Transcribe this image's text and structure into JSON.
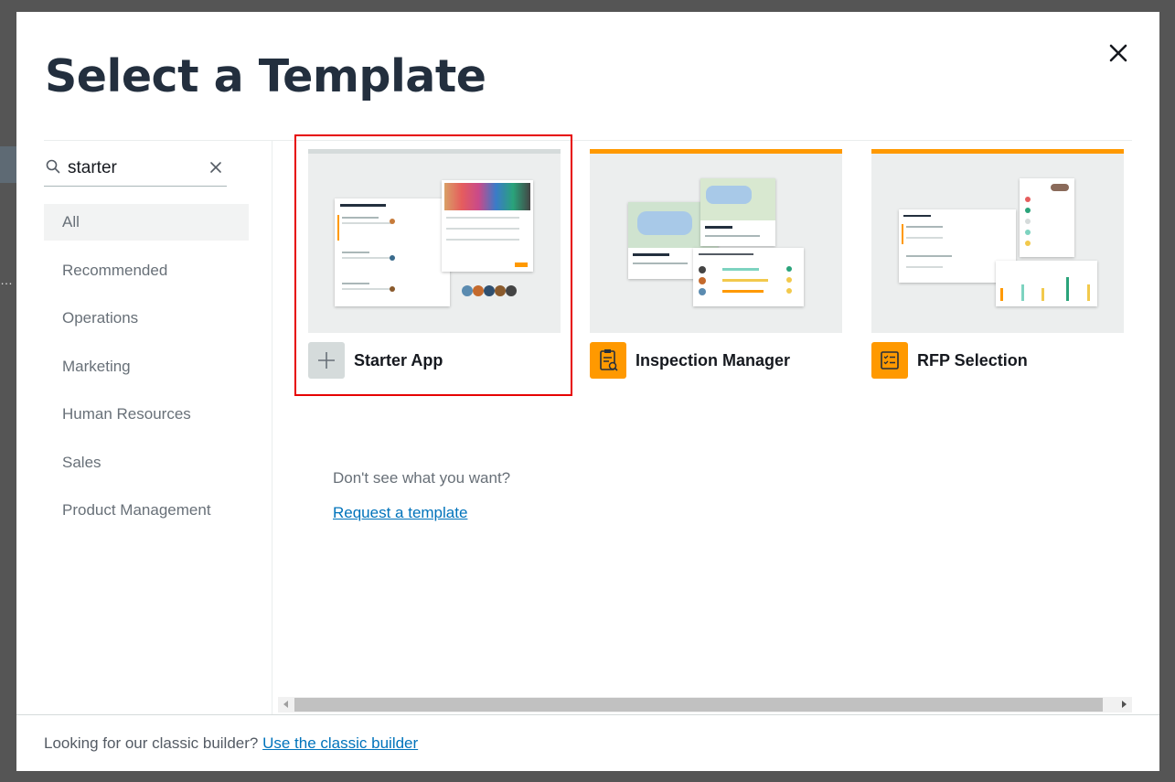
{
  "modal": {
    "title": "Select a Template"
  },
  "search": {
    "value": "starter",
    "placeholder": "Search"
  },
  "categories": [
    {
      "label": "All",
      "active": true
    },
    {
      "label": "Recommended"
    },
    {
      "label": "Operations"
    },
    {
      "label": "Marketing"
    },
    {
      "label": "Human Resources"
    },
    {
      "label": "Sales"
    },
    {
      "label": "Product Management"
    }
  ],
  "templates": [
    {
      "name": "Starter App",
      "icon": "plus-icon",
      "accent": "#d5dbdb",
      "selected": true
    },
    {
      "name": "Inspection Manager",
      "icon": "clipboard-search-icon",
      "accent": "#ff9900"
    },
    {
      "name": "RFP Selection",
      "icon": "checklist-icon",
      "accent": "#ff9900"
    }
  ],
  "help": {
    "text": "Don't see what you want?",
    "link": "Request a template"
  },
  "footer": {
    "text": "Looking for our classic builder?",
    "link": "Use the classic builder"
  },
  "colors": {
    "accent": "#ff9900",
    "link": "#0073bb",
    "title": "#232f3e",
    "selection": "#e60000"
  }
}
